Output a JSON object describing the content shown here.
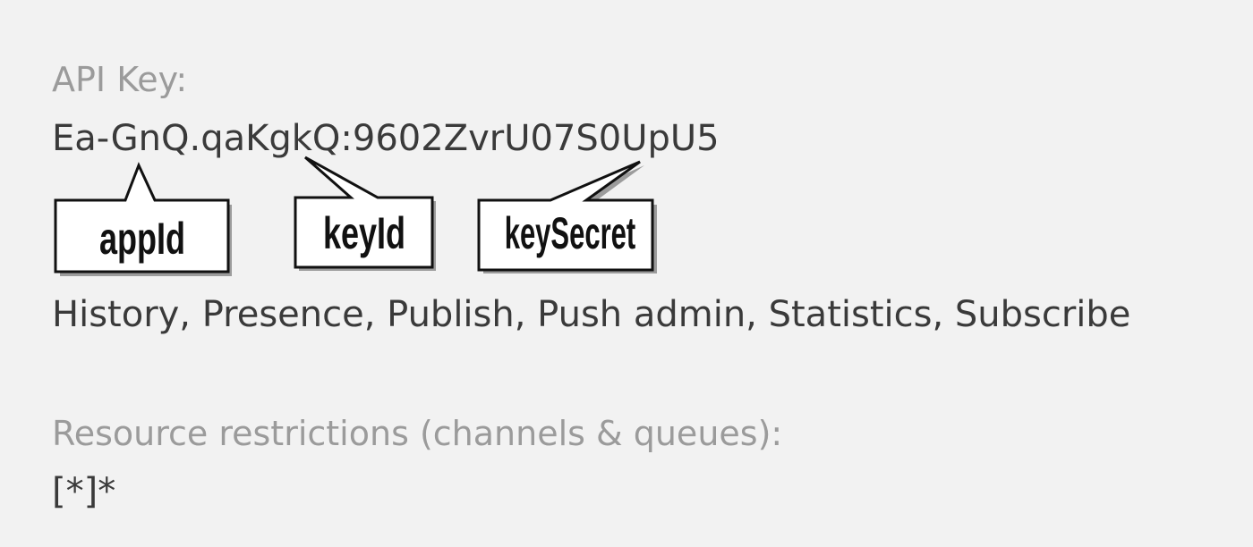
{
  "api_key": {
    "label": "API Key:",
    "value": "Ea-GnQ.qaKgkQ:9602ZvrU07S0UpU5"
  },
  "capabilities": {
    "value": "History, Presence, Publish, Push admin, Statistics, Subscribe"
  },
  "resource_restrictions": {
    "label": "Resource restrictions (channels & queues):",
    "value": "[*]*"
  },
  "callouts": {
    "app_id": "appId",
    "key_id": "keyId",
    "key_secret": "keySecret"
  }
}
